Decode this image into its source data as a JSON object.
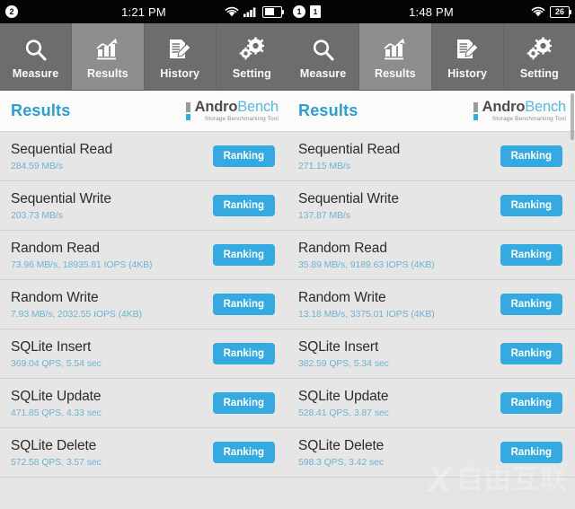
{
  "panels": [
    {
      "statusbar": {
        "left_badge": "2",
        "time": "1:21 PM",
        "icons": [
          "wifi-icon",
          "signal-icon",
          "battery-icon"
        ],
        "battery_level": ""
      },
      "tabs": [
        {
          "label": "Measure",
          "icon": "search-icon",
          "active": false
        },
        {
          "label": "Results",
          "icon": "chart-icon",
          "active": true
        },
        {
          "label": "History",
          "icon": "document-edit-icon",
          "active": false
        },
        {
          "label": "Setting",
          "icon": "gears-icon",
          "active": false
        }
      ],
      "header": {
        "title": "Results",
        "logo_primary": "Andro",
        "logo_secondary": "Bench",
        "logo_tagline": "Storage Benchmarking Tool"
      },
      "rows": [
        {
          "title": "Sequential Read",
          "value": "284.59 MB/s",
          "button": "Ranking"
        },
        {
          "title": "Sequential Write",
          "value": "203.73 MB/s",
          "button": "Ranking"
        },
        {
          "title": "Random Read",
          "value": "73.96 MB/s, 18935.81 IOPS (4KB)",
          "button": "Ranking"
        },
        {
          "title": "Random Write",
          "value": "7.93 MB/s, 2032.55 IOPS (4KB)",
          "button": "Ranking"
        },
        {
          "title": "SQLite Insert",
          "value": "369.04 QPS, 5.54 sec",
          "button": "Ranking"
        },
        {
          "title": "SQLite Update",
          "value": "471.85 QPS, 4.33 sec",
          "button": "Ranking"
        },
        {
          "title": "SQLite Delete",
          "value": "572.58 QPS, 3.57 sec",
          "button": "Ranking"
        }
      ]
    },
    {
      "statusbar": {
        "left_badge": "1",
        "time": "1:48 PM",
        "icons": [
          "sim-icon",
          "wifi-icon",
          "battery-icon"
        ],
        "battery_level": "26"
      },
      "tabs": [
        {
          "label": "Measure",
          "icon": "search-icon",
          "active": false
        },
        {
          "label": "Results",
          "icon": "chart-icon",
          "active": true
        },
        {
          "label": "History",
          "icon": "document-edit-icon",
          "active": false
        },
        {
          "label": "Setting",
          "icon": "gears-icon",
          "active": false
        }
      ],
      "header": {
        "title": "Results",
        "logo_primary": "Andro",
        "logo_secondary": "Bench",
        "logo_tagline": "Storage Benchmarking Tool"
      },
      "rows": [
        {
          "title": "Sequential Read",
          "value": "271.15 MB/s",
          "button": "Ranking"
        },
        {
          "title": "Sequential Write",
          "value": "137.87 MB/s",
          "button": "Ranking"
        },
        {
          "title": "Random Read",
          "value": "35.89 MB/s, 9189.63 IOPS (4KB)",
          "button": "Ranking"
        },
        {
          "title": "Random Write",
          "value": "13.18 MB/s, 3375.01 IOPS (4KB)",
          "button": "Ranking"
        },
        {
          "title": "SQLite Insert",
          "value": "382.59 QPS, 5.34 sec",
          "button": "Ranking"
        },
        {
          "title": "SQLite Update",
          "value": "528.41 QPS, 3.87 sec",
          "button": "Ranking"
        },
        {
          "title": "SQLite Delete",
          "value": "598.3 QPS, 3.42 sec",
          "button": "Ranking"
        }
      ]
    }
  ],
  "watermark": {
    "mark": "X",
    "text": "自由互联"
  },
  "colors": {
    "accent_blue": "#34aae0",
    "title_blue": "#2e9ccc",
    "value_blue": "#6fb2d4",
    "tabbar_gray": "#6d6d6d",
    "tab_active_gray": "#8d8d8d",
    "list_bg": "#e6e6e6",
    "statusbar_black": "#050505"
  }
}
